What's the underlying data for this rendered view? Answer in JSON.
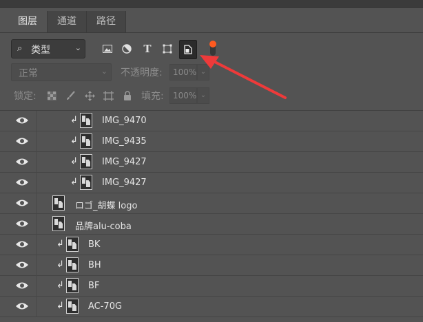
{
  "tabs": [
    {
      "label": "图层"
    },
    {
      "label": "通道"
    },
    {
      "label": "路径"
    }
  ],
  "filter": {
    "kind_label": "类型",
    "icons": [
      "image-filter-icon",
      "adjustment-filter-icon",
      "type-filter-icon",
      "shape-filter-icon",
      "smart-object-filter-icon"
    ],
    "toggle_color": "#ff5a1f"
  },
  "blend": {
    "mode": "正常",
    "opacity_label": "不透明度:",
    "opacity_value": "100%"
  },
  "lock": {
    "label": "锁定:",
    "fill_label": "填充:",
    "fill_value": "100%"
  },
  "layers": [
    {
      "name": "IMG_9470",
      "clipped": true
    },
    {
      "name": "IMG_9435",
      "clipped": true
    },
    {
      "name": "IMG_9427",
      "clipped": true
    },
    {
      "name": "IMG_9427",
      "clipped": true
    },
    {
      "name": "ロゴ_胡蝶 logo",
      "clipped": false
    },
    {
      "name": "品牌alu-coba",
      "clipped": false
    },
    {
      "name": "BK",
      "clipped": true
    },
    {
      "name": "BH",
      "clipped": true
    },
    {
      "name": "BF",
      "clipped": true
    },
    {
      "name": "AC-70G",
      "clipped": true
    }
  ],
  "annotation_color": "#ee3a3a"
}
